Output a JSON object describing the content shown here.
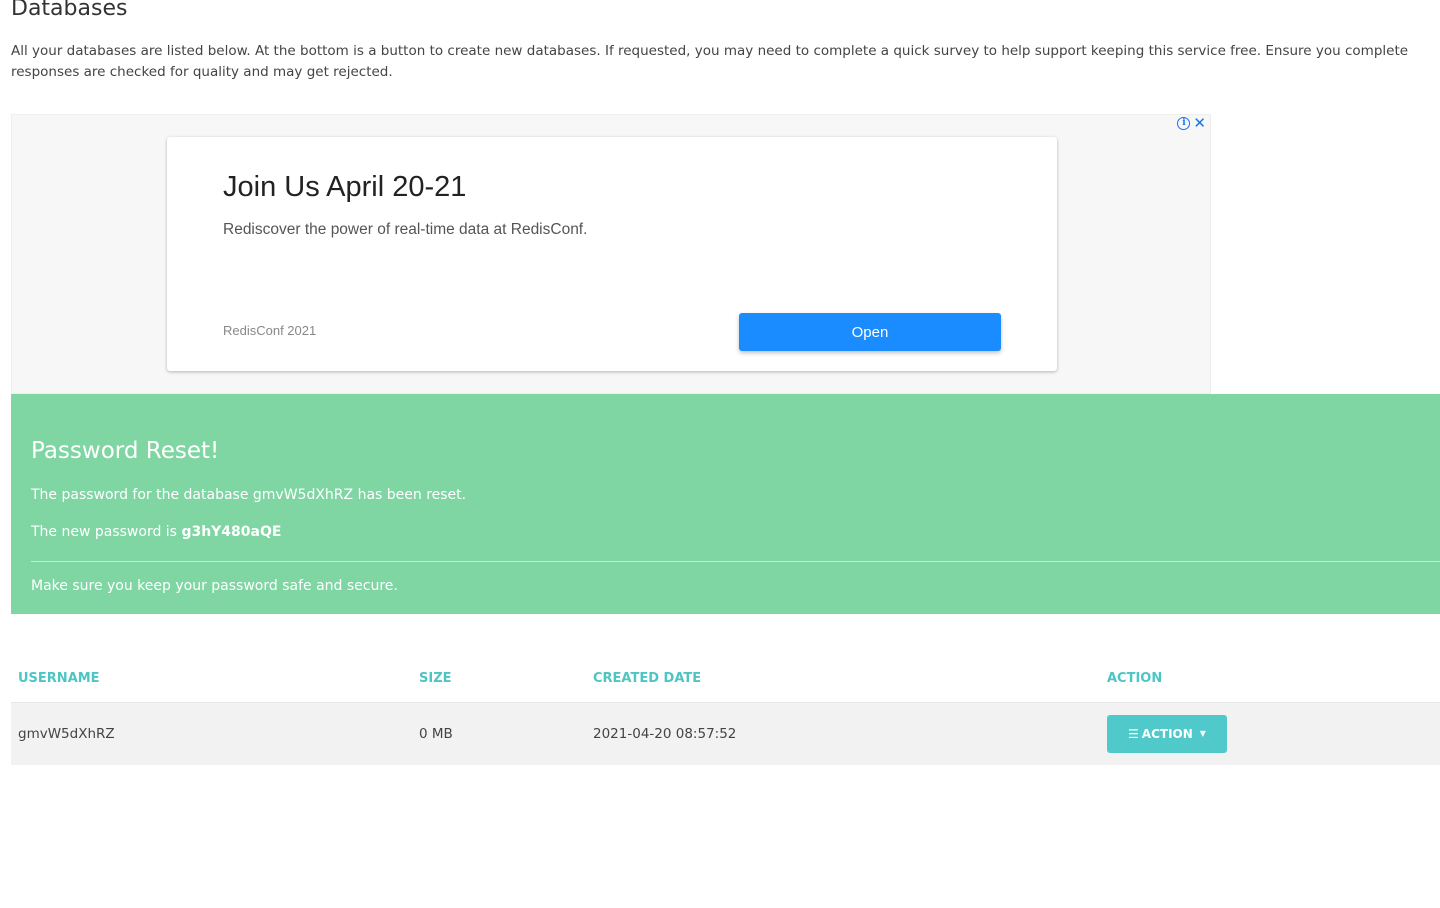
{
  "page": {
    "title": "Databases",
    "intro": "All your databases are listed below. At the bottom is a button to create new databases. If requested, you may need to complete a quick survey to help support keeping this service free. Ensure you complete responses are checked for quality and may get rejected."
  },
  "ad": {
    "headline": "Join Us April 20-21",
    "body": "Rediscover the power of real-time data at RedisConf.",
    "advertiser": "RedisConf 2021",
    "cta_label": "Open",
    "info_icon": "i",
    "close_icon": "✕",
    "cta_color": "#1a8cff"
  },
  "alert": {
    "heading": "Password Reset!",
    "line1": "The password for the database gmvW5dXhRZ has been reset.",
    "line2_prefix": "The new password is ",
    "new_password": "g3hY480aQE",
    "footer": "Make sure you keep your password safe and secure.",
    "color": "#7fd6a3"
  },
  "table": {
    "headers": {
      "username": "USERNAME",
      "size": "SIZE",
      "created": "CREATED DATE",
      "action": "ACTION"
    },
    "rows": [
      {
        "username": "gmvW5dXhRZ",
        "size": "0 MB",
        "created": "2021-04-20 08:57:52",
        "action_label": "ACTION"
      }
    ],
    "accent_color": "#4dc5c4"
  }
}
